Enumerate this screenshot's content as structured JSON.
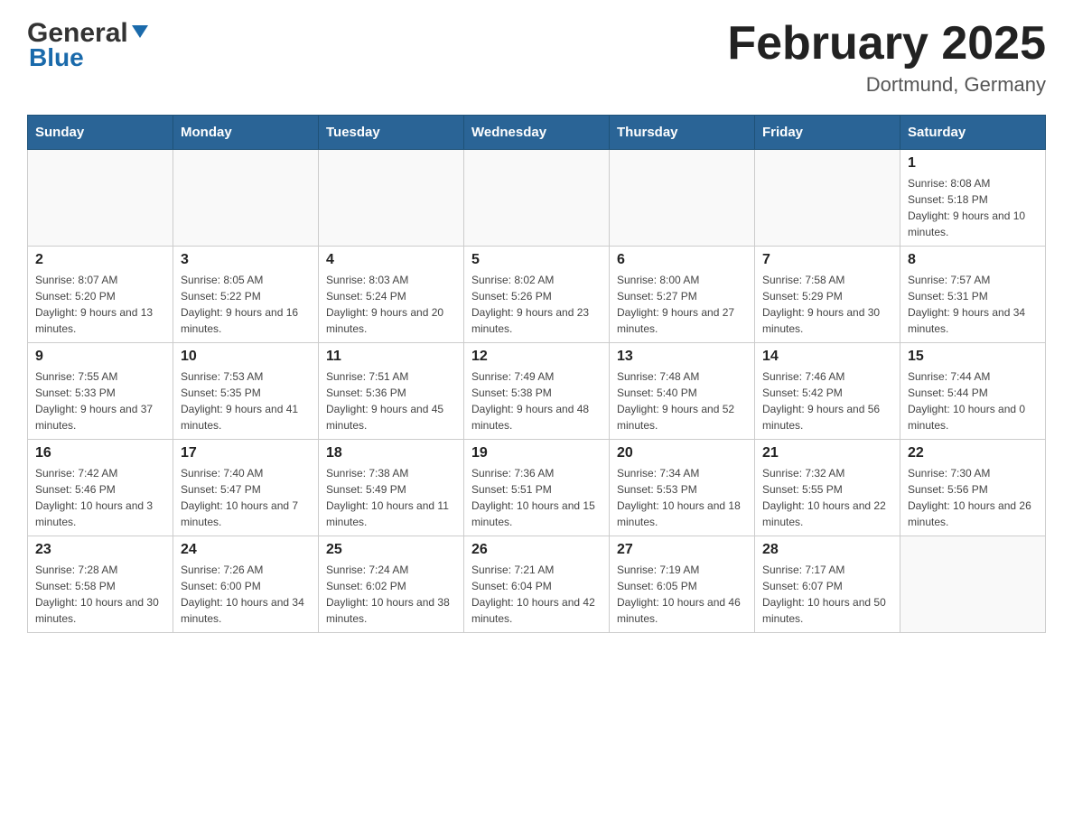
{
  "header": {
    "logo_general": "General",
    "logo_blue": "Blue",
    "title": "February 2025",
    "location": "Dortmund, Germany"
  },
  "days_of_week": [
    "Sunday",
    "Monday",
    "Tuesday",
    "Wednesday",
    "Thursday",
    "Friday",
    "Saturday"
  ],
  "weeks": [
    [
      {
        "day": "",
        "info": ""
      },
      {
        "day": "",
        "info": ""
      },
      {
        "day": "",
        "info": ""
      },
      {
        "day": "",
        "info": ""
      },
      {
        "day": "",
        "info": ""
      },
      {
        "day": "",
        "info": ""
      },
      {
        "day": "1",
        "info": "Sunrise: 8:08 AM\nSunset: 5:18 PM\nDaylight: 9 hours and 10 minutes."
      }
    ],
    [
      {
        "day": "2",
        "info": "Sunrise: 8:07 AM\nSunset: 5:20 PM\nDaylight: 9 hours and 13 minutes."
      },
      {
        "day": "3",
        "info": "Sunrise: 8:05 AM\nSunset: 5:22 PM\nDaylight: 9 hours and 16 minutes."
      },
      {
        "day": "4",
        "info": "Sunrise: 8:03 AM\nSunset: 5:24 PM\nDaylight: 9 hours and 20 minutes."
      },
      {
        "day": "5",
        "info": "Sunrise: 8:02 AM\nSunset: 5:26 PM\nDaylight: 9 hours and 23 minutes."
      },
      {
        "day": "6",
        "info": "Sunrise: 8:00 AM\nSunset: 5:27 PM\nDaylight: 9 hours and 27 minutes."
      },
      {
        "day": "7",
        "info": "Sunrise: 7:58 AM\nSunset: 5:29 PM\nDaylight: 9 hours and 30 minutes."
      },
      {
        "day": "8",
        "info": "Sunrise: 7:57 AM\nSunset: 5:31 PM\nDaylight: 9 hours and 34 minutes."
      }
    ],
    [
      {
        "day": "9",
        "info": "Sunrise: 7:55 AM\nSunset: 5:33 PM\nDaylight: 9 hours and 37 minutes."
      },
      {
        "day": "10",
        "info": "Sunrise: 7:53 AM\nSunset: 5:35 PM\nDaylight: 9 hours and 41 minutes."
      },
      {
        "day": "11",
        "info": "Sunrise: 7:51 AM\nSunset: 5:36 PM\nDaylight: 9 hours and 45 minutes."
      },
      {
        "day": "12",
        "info": "Sunrise: 7:49 AM\nSunset: 5:38 PM\nDaylight: 9 hours and 48 minutes."
      },
      {
        "day": "13",
        "info": "Sunrise: 7:48 AM\nSunset: 5:40 PM\nDaylight: 9 hours and 52 minutes."
      },
      {
        "day": "14",
        "info": "Sunrise: 7:46 AM\nSunset: 5:42 PM\nDaylight: 9 hours and 56 minutes."
      },
      {
        "day": "15",
        "info": "Sunrise: 7:44 AM\nSunset: 5:44 PM\nDaylight: 10 hours and 0 minutes."
      }
    ],
    [
      {
        "day": "16",
        "info": "Sunrise: 7:42 AM\nSunset: 5:46 PM\nDaylight: 10 hours and 3 minutes."
      },
      {
        "day": "17",
        "info": "Sunrise: 7:40 AM\nSunset: 5:47 PM\nDaylight: 10 hours and 7 minutes."
      },
      {
        "day": "18",
        "info": "Sunrise: 7:38 AM\nSunset: 5:49 PM\nDaylight: 10 hours and 11 minutes."
      },
      {
        "day": "19",
        "info": "Sunrise: 7:36 AM\nSunset: 5:51 PM\nDaylight: 10 hours and 15 minutes."
      },
      {
        "day": "20",
        "info": "Sunrise: 7:34 AM\nSunset: 5:53 PM\nDaylight: 10 hours and 18 minutes."
      },
      {
        "day": "21",
        "info": "Sunrise: 7:32 AM\nSunset: 5:55 PM\nDaylight: 10 hours and 22 minutes."
      },
      {
        "day": "22",
        "info": "Sunrise: 7:30 AM\nSunset: 5:56 PM\nDaylight: 10 hours and 26 minutes."
      }
    ],
    [
      {
        "day": "23",
        "info": "Sunrise: 7:28 AM\nSunset: 5:58 PM\nDaylight: 10 hours and 30 minutes."
      },
      {
        "day": "24",
        "info": "Sunrise: 7:26 AM\nSunset: 6:00 PM\nDaylight: 10 hours and 34 minutes."
      },
      {
        "day": "25",
        "info": "Sunrise: 7:24 AM\nSunset: 6:02 PM\nDaylight: 10 hours and 38 minutes."
      },
      {
        "day": "26",
        "info": "Sunrise: 7:21 AM\nSunset: 6:04 PM\nDaylight: 10 hours and 42 minutes."
      },
      {
        "day": "27",
        "info": "Sunrise: 7:19 AM\nSunset: 6:05 PM\nDaylight: 10 hours and 46 minutes."
      },
      {
        "day": "28",
        "info": "Sunrise: 7:17 AM\nSunset: 6:07 PM\nDaylight: 10 hours and 50 minutes."
      },
      {
        "day": "",
        "info": ""
      }
    ]
  ]
}
